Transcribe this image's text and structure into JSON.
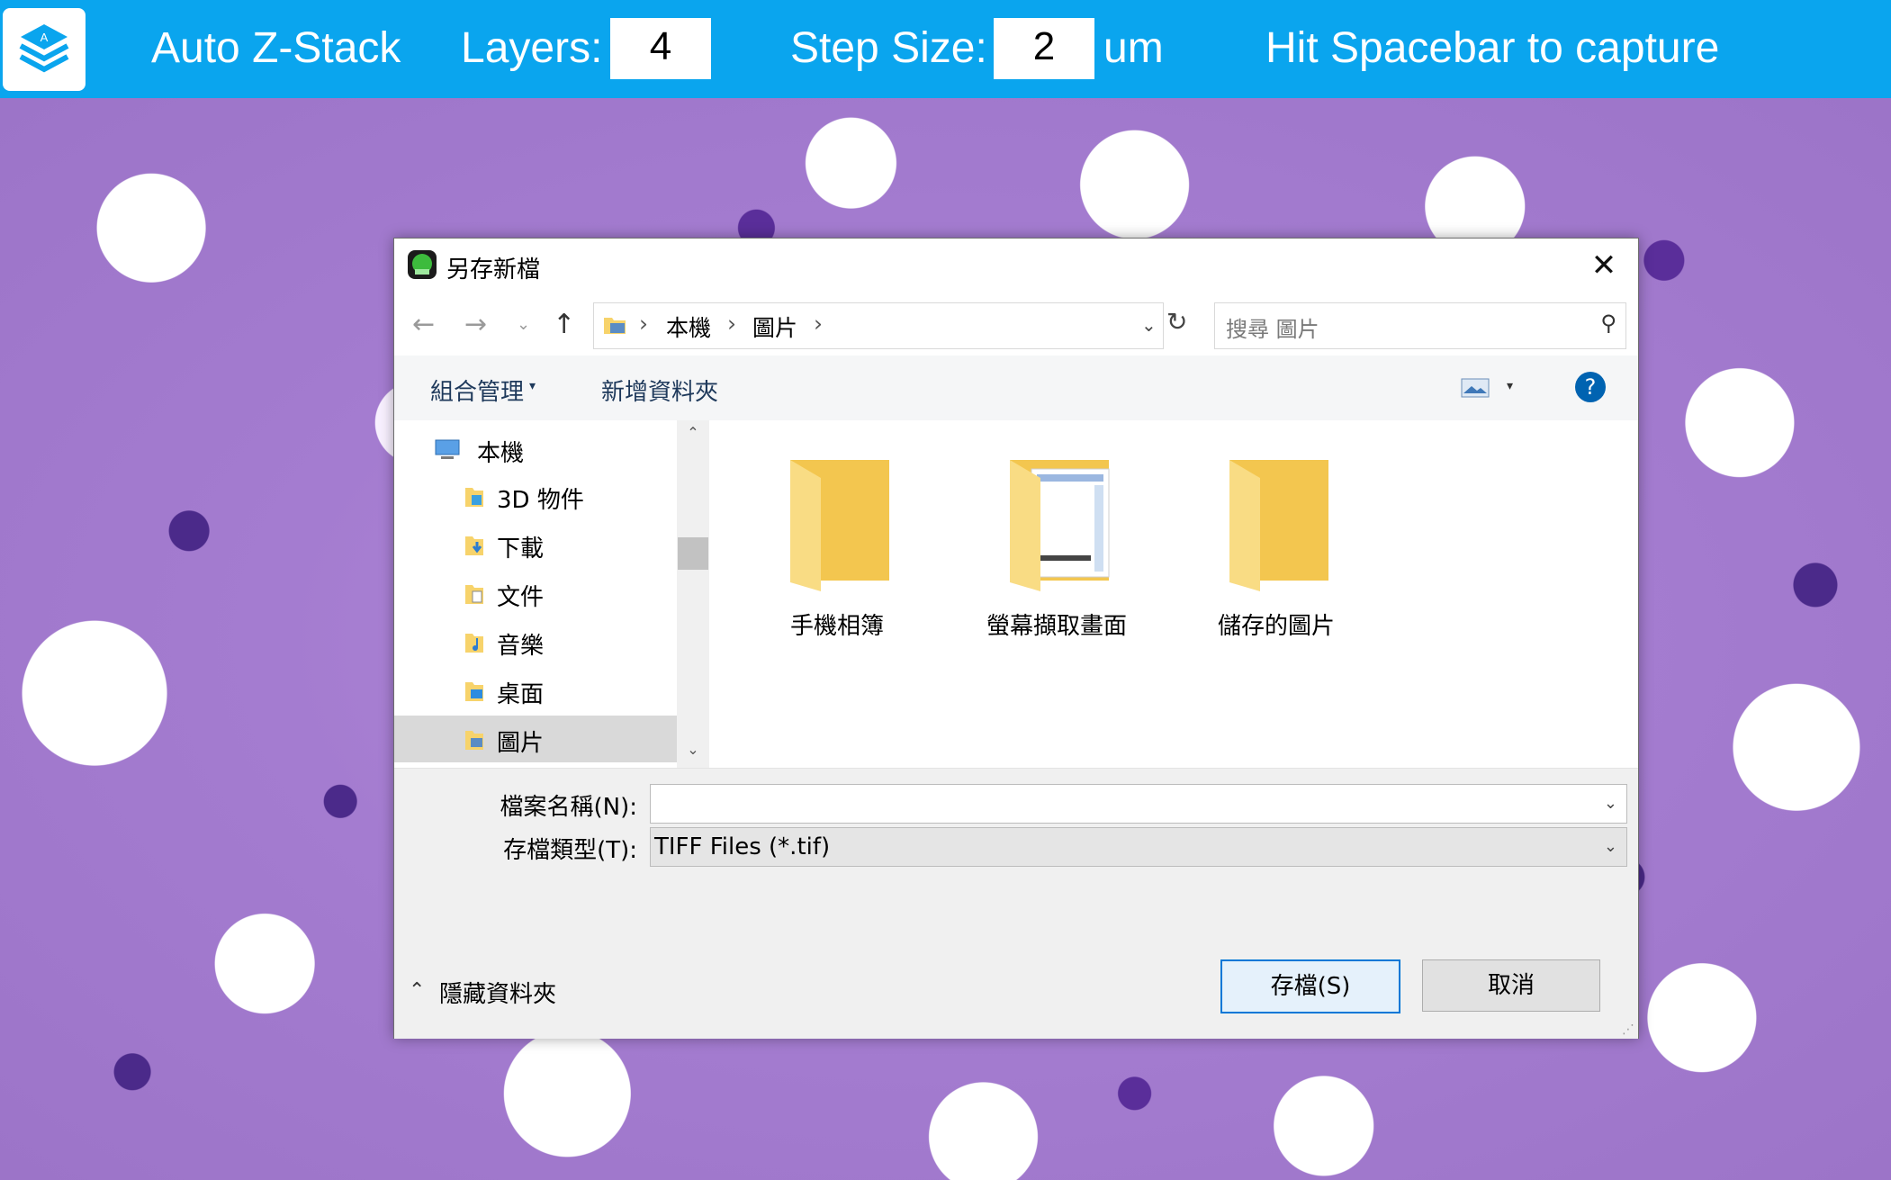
{
  "toolbar": {
    "app_name": "Auto Z-Stack",
    "layers_label": "Layers:",
    "layers_value": "4",
    "step_label": "Step Size:",
    "step_value": "2",
    "step_unit": "um",
    "hint": "Hit Spacebar to capture",
    "logo_letter": "A"
  },
  "dialog": {
    "title": "另存新檔",
    "address_crumbs": [
      "本機",
      "圖片"
    ],
    "search_placeholder": "搜尋 圖片",
    "commands": {
      "organize": "組合管理",
      "new_folder": "新增資料夾"
    },
    "nav_items": [
      {
        "label": "本機",
        "icon": "computer-icon"
      },
      {
        "label": "3D 物件",
        "icon": "3d-objects-icon"
      },
      {
        "label": "下載",
        "icon": "downloads-icon"
      },
      {
        "label": "文件",
        "icon": "documents-icon"
      },
      {
        "label": "音樂",
        "icon": "music-icon"
      },
      {
        "label": "桌面",
        "icon": "desktop-icon"
      },
      {
        "label": "圖片",
        "icon": "pictures-icon",
        "selected": true
      }
    ],
    "folders": [
      {
        "name": "手機相簿"
      },
      {
        "name": "螢幕擷取畫面"
      },
      {
        "name": "儲存的圖片"
      }
    ],
    "filename_label": "檔案名稱(N):",
    "filename_value": "",
    "filetype_label": "存檔類型(T):",
    "filetype_value": "TIFF Files (*.tif)",
    "hide_folders": "隱藏資料夾",
    "save_button": "存檔(S)",
    "cancel_button": "取消"
  },
  "colors": {
    "toolbar_bg": "#0aa5ee",
    "folder_yellow": "#f7d36b",
    "accent": "#0063b1"
  }
}
